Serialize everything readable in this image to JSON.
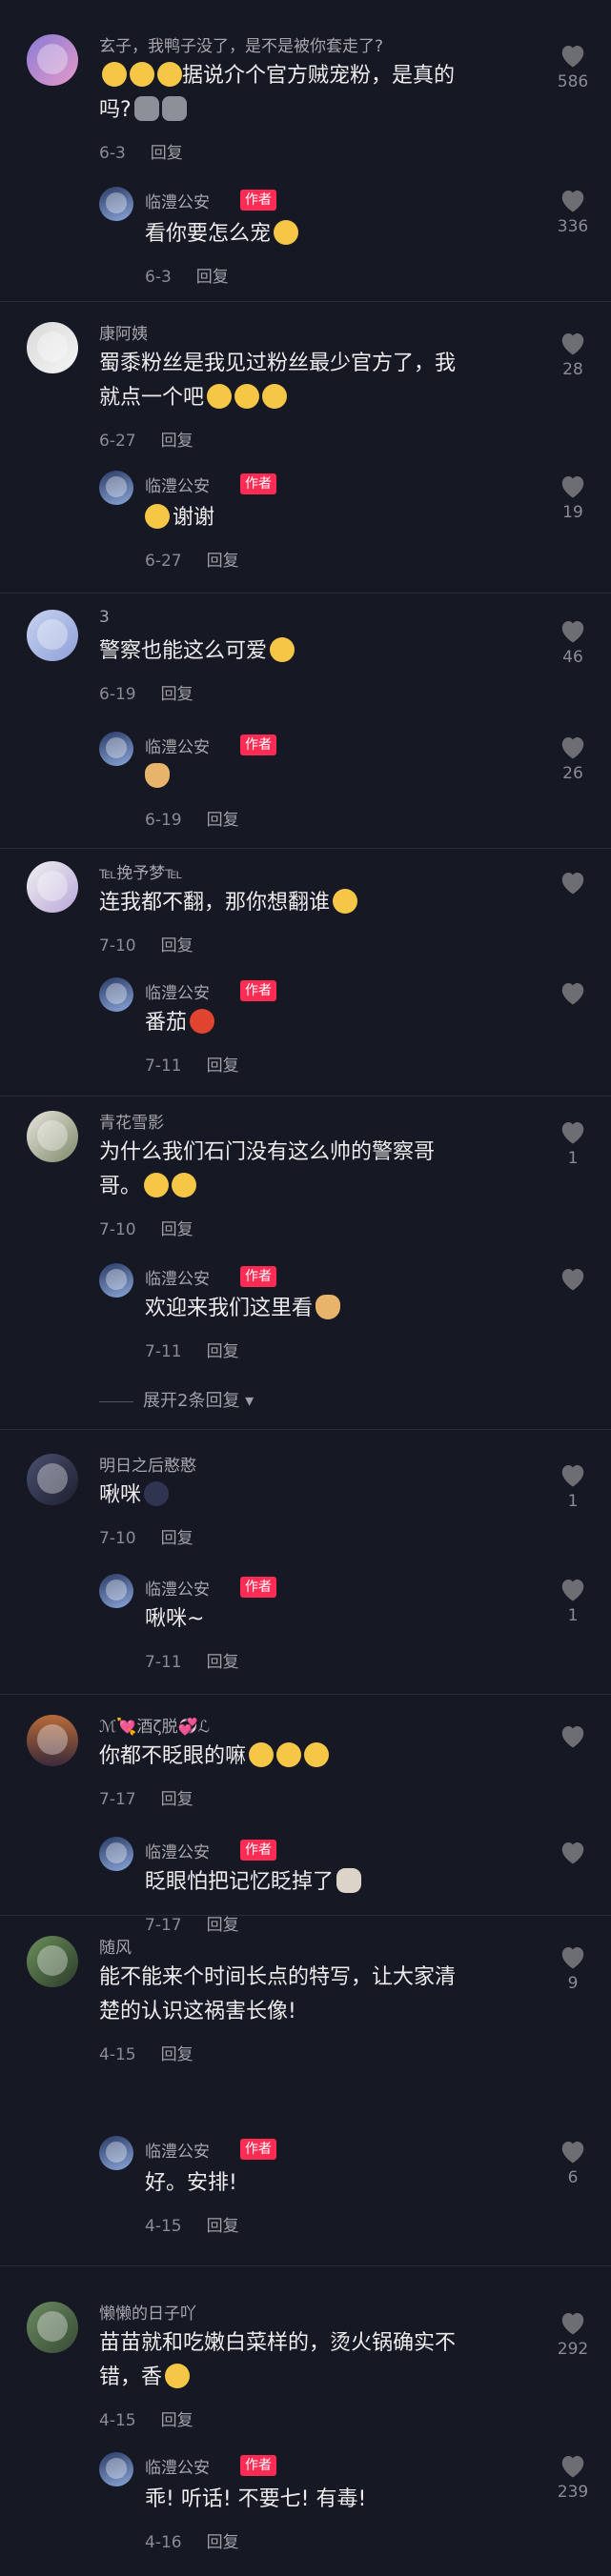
{
  "comments": [
    {
      "name": "玄子，我鸭子没了，是不是被你套走了?",
      "text_lines": [
        "据说介个官方贼宠粉，是真的",
        "吗?"
      ],
      "date": "6-3",
      "reply": "回复",
      "likes": "586",
      "author_reply": {
        "name": "临澧公安",
        "tag": "作者",
        "text": "看你要怎么宠",
        "date": "6-3",
        "reply": "回复",
        "likes": "336"
      }
    },
    {
      "name": "康阿姨",
      "text_lines": [
        "蜀黍粉丝是我见过粉丝最少官方了，我",
        "就点一个吧"
      ],
      "date": "6-27",
      "reply": "回复",
      "likes": "28",
      "author_reply": {
        "name": "临澧公安",
        "tag": "作者",
        "text": "谢谢",
        "date": "6-27",
        "reply": "回复",
        "likes": "19"
      }
    },
    {
      "name": "3",
      "text_lines": [
        "警察也能这么可爱"
      ],
      "date": "6-19",
      "reply": "回复",
      "likes": "46",
      "author_reply": {
        "name": "临澧公安",
        "tag": "作者",
        "text": "",
        "date": "6-19",
        "reply": "回复",
        "likes": "26"
      }
    },
    {
      "name": "℡挽予梦℡",
      "text_lines": [
        "连我都不翻，那你想翻谁"
      ],
      "date": "7-10",
      "reply": "回复",
      "likes": "",
      "author_reply": {
        "name": "临澧公安",
        "tag": "作者",
        "text": "番茄",
        "date": "7-11",
        "reply": "回复",
        "likes": ""
      }
    },
    {
      "name": "青花雪影",
      "text_lines": [
        "为什么我们石门没有这么帅的警察哥",
        "哥。"
      ],
      "date": "7-10",
      "reply": "回复",
      "likes": "1",
      "author_reply": {
        "name": "临澧公安",
        "tag": "作者",
        "text": "欢迎来我们这里看",
        "date": "7-11",
        "reply": "回复",
        "likes": ""
      },
      "expand": "展开2条回复"
    },
    {
      "name": "明日之后憨憨",
      "text_lines": [
        "啾咪"
      ],
      "date": "7-10",
      "reply": "回复",
      "likes": "1",
      "author_reply": {
        "name": "临澧公安",
        "tag": "作者",
        "text": "啾咪~",
        "date": "7-11",
        "reply": "回复",
        "likes": "1"
      }
    },
    {
      "name": "ℳ💘酒ζ脱💞ℒ",
      "text_lines": [
        "你都不眨眼的嘛"
      ],
      "date": "7-17",
      "reply": "回复",
      "likes": "",
      "author_reply": {
        "name": "临澧公安",
        "tag": "作者",
        "text": "眨眼怕把记忆眨掉了",
        "date": "7-17",
        "reply": "回复",
        "likes": ""
      }
    },
    {
      "name": "随风",
      "text_lines": [
        "能不能来个时间长点的特写，让大家清",
        "楚的认识这祸害长像!"
      ],
      "date": "4-15",
      "reply": "回复",
      "likes": "9",
      "author_reply": {
        "name": "临澧公安",
        "tag": "作者",
        "text": "好。安排!",
        "date": "4-15",
        "reply": "回复",
        "likes": "6"
      }
    },
    {
      "name": "懒懒的日子吖",
      "text_lines": [
        "苗苗就和吃嫩白菜样的，烫火锅确实不",
        "错，香"
      ],
      "date": "4-15",
      "reply": "回复",
      "likes": "292",
      "author_reply": {
        "name": "临澧公安",
        "tag": "作者",
        "text": "乖! 听话! 不要七! 有毒!",
        "date": "4-16",
        "reply": "回复",
        "likes": "239"
      }
    }
  ],
  "colors": {
    "background": "#161823",
    "author_tag": "#fe2c55",
    "muted": "#8b8c92"
  }
}
